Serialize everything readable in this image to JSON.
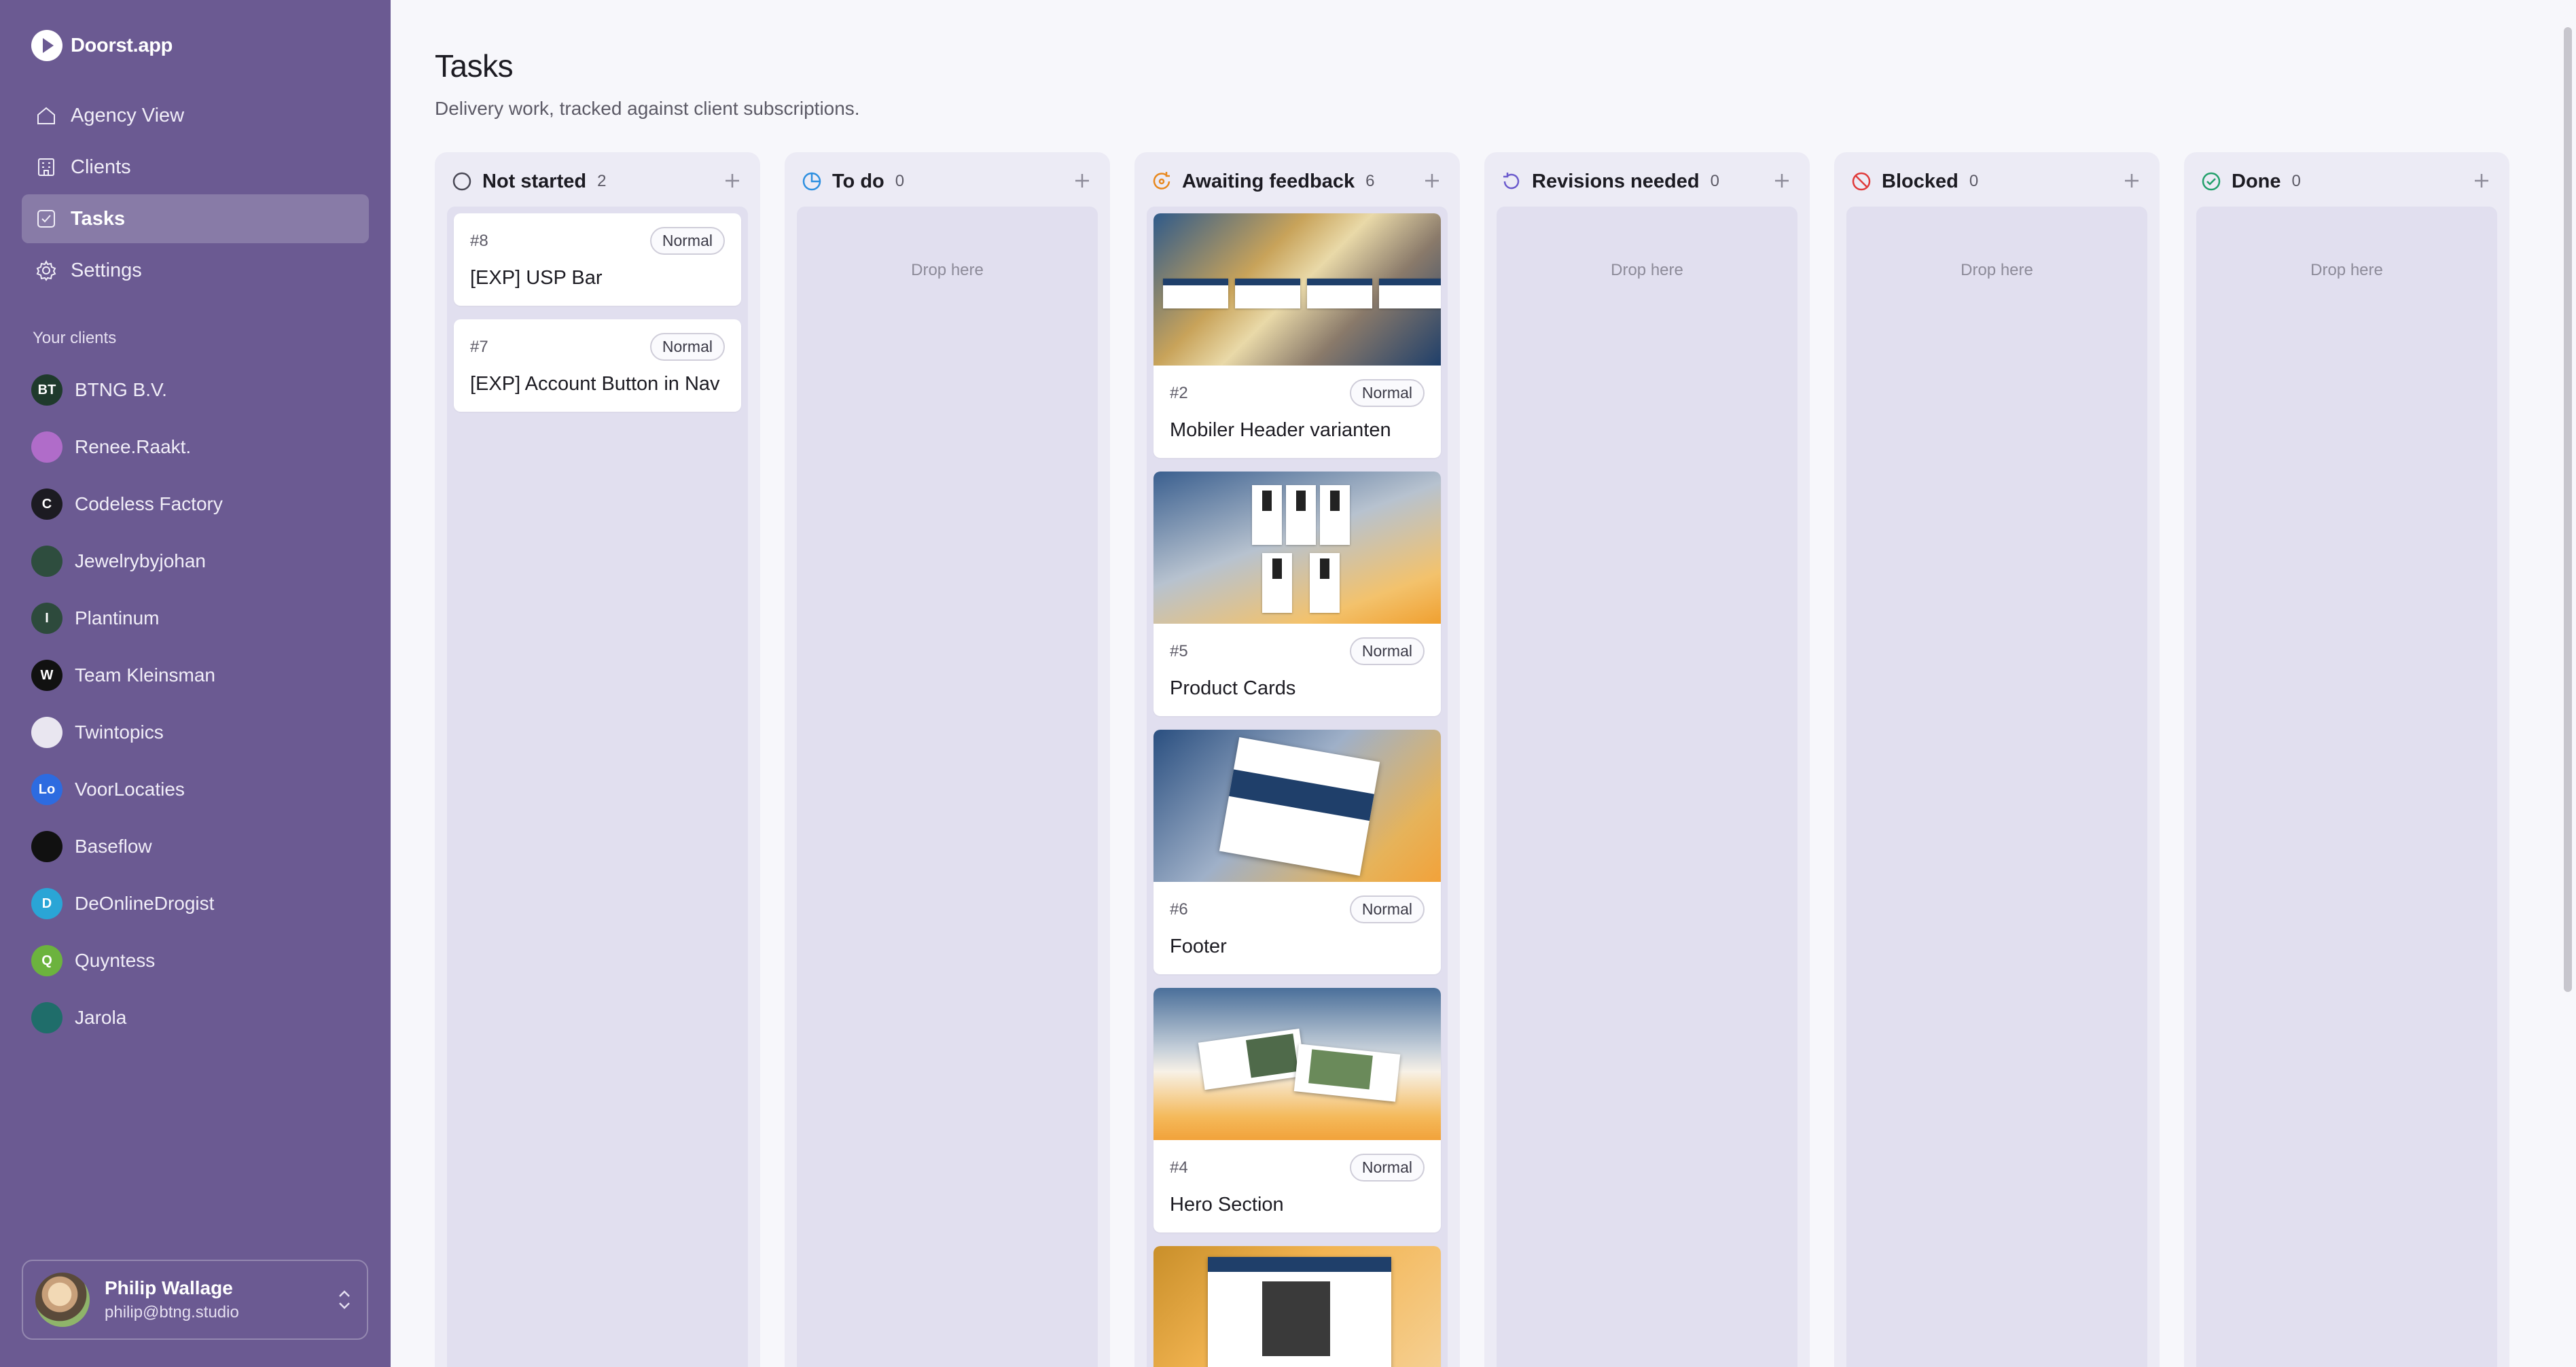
{
  "brand": {
    "name": "Doorst.app"
  },
  "nav": [
    {
      "label": "Agency View",
      "icon": "home-icon",
      "active": false
    },
    {
      "label": "Clients",
      "icon": "building-icon",
      "active": false
    },
    {
      "label": "Tasks",
      "icon": "checkbox-icon",
      "active": true
    },
    {
      "label": "Settings",
      "icon": "gear-icon",
      "active": false
    }
  ],
  "clients_section": {
    "label": "Your clients"
  },
  "clients": [
    {
      "name": "BTNG B.V.",
      "avatar_text": "BT",
      "color": "#1f3a2c"
    },
    {
      "name": "Renee.Raakt.",
      "avatar_text": "",
      "color": "#b06cc9"
    },
    {
      "name": "Codeless Factory",
      "avatar_text": "C",
      "color": "#1c1b22"
    },
    {
      "name": "Jewelrybyjohan",
      "avatar_text": "",
      "color": "#2e4d3e"
    },
    {
      "name": "Plantinum",
      "avatar_text": "I",
      "color": "#2d4a3c"
    },
    {
      "name": "Team Kleinsman",
      "avatar_text": "W",
      "color": "#111111"
    },
    {
      "name": "Twintopics",
      "avatar_text": "",
      "color": "#e9e6f0"
    },
    {
      "name": "VoorLocaties",
      "avatar_text": "Lo",
      "color": "#2d6be0"
    },
    {
      "name": "Baseflow",
      "avatar_text": "",
      "color": "#111111"
    },
    {
      "name": "DeOnlineDrogist",
      "avatar_text": "D",
      "color": "#2aa5d6"
    },
    {
      "name": "Quyntess",
      "avatar_text": "Q",
      "color": "#6cb33e"
    },
    {
      "name": "Jarola",
      "avatar_text": "",
      "color": "#1f6d6a"
    }
  ],
  "user": {
    "name": "Philip Wallage",
    "email": "philip@btng.studio"
  },
  "page": {
    "title": "Tasks",
    "subtitle": "Delivery work, tracked against client subscriptions."
  },
  "columns": [
    {
      "title": "Not started",
      "count": "2",
      "icon": "circle-icon",
      "icon_color": "#4a4956",
      "empty_label": "",
      "cards": [
        {
          "id": "#8",
          "badge": "Normal",
          "title": "[EXP] USP Bar",
          "thumb": ""
        },
        {
          "id": "#7",
          "badge": "Normal",
          "title": "[EXP] Account Button in Nav",
          "thumb": ""
        }
      ]
    },
    {
      "title": "To do",
      "count": "0",
      "icon": "clock-pie-icon",
      "icon_color": "#2d8fe0",
      "empty_label": "Drop here",
      "cards": []
    },
    {
      "title": "Awaiting feedback",
      "count": "6",
      "icon": "refresh-icon",
      "icon_color": "#e8881e",
      "empty_label": "",
      "cards": [
        {
          "id": "#2",
          "badge": "Normal",
          "title": "Mobiler Header varianten",
          "thumb": "headers"
        },
        {
          "id": "#5",
          "badge": "Normal",
          "title": "Product Cards",
          "thumb": "products"
        },
        {
          "id": "#6",
          "badge": "Normal",
          "title": "Footer",
          "thumb": "footer"
        },
        {
          "id": "#4",
          "badge": "Normal",
          "title": "Hero Section",
          "thumb": "hero"
        },
        {
          "id": "",
          "badge": "",
          "title": "",
          "thumb": "page"
        }
      ]
    },
    {
      "title": "Revisions needed",
      "count": "0",
      "icon": "undo-icon",
      "icon_color": "#6b5acd",
      "empty_label": "Drop here",
      "cards": []
    },
    {
      "title": "Blocked",
      "count": "0",
      "icon": "ban-icon",
      "icon_color": "#e03a3a",
      "empty_label": "Drop here",
      "cards": []
    },
    {
      "title": "Done",
      "count": "0",
      "icon": "check-circle-icon",
      "icon_color": "#22a06b",
      "empty_label": "Drop here",
      "cards": []
    }
  ]
}
